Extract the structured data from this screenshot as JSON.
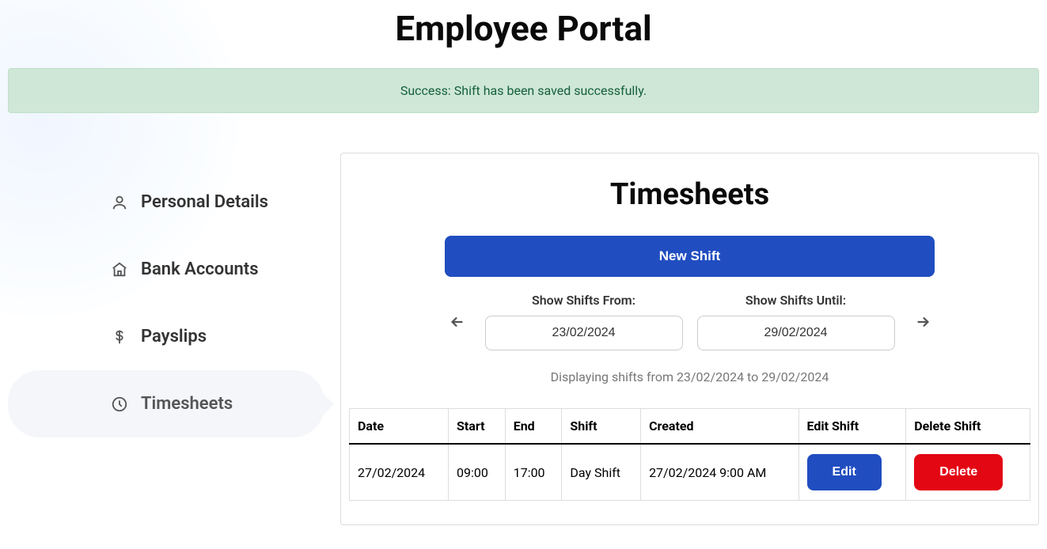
{
  "header": {
    "title": "Employee Portal"
  },
  "alert": {
    "message": "Success: Shift has been saved successfully."
  },
  "sidebar": {
    "items": [
      {
        "label": "Personal Details"
      },
      {
        "label": "Bank Accounts"
      },
      {
        "label": "Payslips"
      },
      {
        "label": "Timesheets"
      }
    ]
  },
  "timesheets": {
    "title": "Timesheets",
    "new_shift_label": "New Shift",
    "from_label": "Show Shifts From:",
    "until_label": "Show Shifts Until:",
    "from_value": "23/02/2024",
    "until_value": "29/02/2024",
    "caption": "Displaying shifts from 23/02/2024 to 29/02/2024",
    "columns": {
      "date": "Date",
      "start": "Start",
      "end": "End",
      "shift": "Shift",
      "created": "Created",
      "edit": "Edit Shift",
      "delete": "Delete Shift"
    },
    "rows": [
      {
        "date": "27/02/2024",
        "start": "09:00",
        "end": "17:00",
        "shift": "Day Shift",
        "created": "27/02/2024 9:00 AM",
        "edit_label": "Edit",
        "delete_label": "Delete"
      }
    ]
  }
}
